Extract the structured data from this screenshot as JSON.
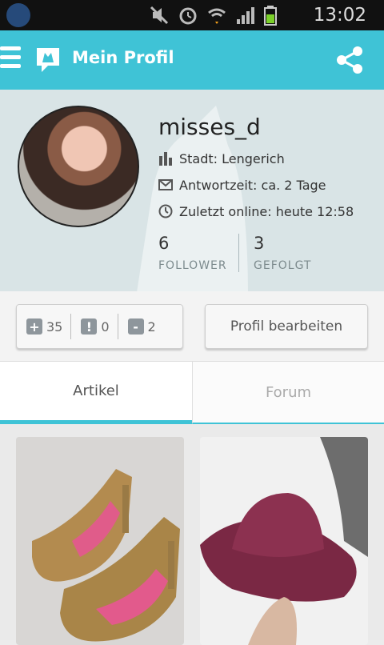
{
  "status_bar": {
    "time": "13:02"
  },
  "app_bar": {
    "title": "Mein Profil"
  },
  "profile": {
    "username": "misses_d",
    "city": "Stadt: Lengerich",
    "reply_time": "Antwortzeit: ca. 2 Tage",
    "last_online": "Zuletzt online: heute 12:58",
    "followers": {
      "count": "6",
      "label": "FOLLOWER"
    },
    "following": {
      "count": "3",
      "label": "GEFOLGT"
    }
  },
  "votes": [
    {
      "symbol": "+",
      "count": "35"
    },
    {
      "symbol": "!",
      "count": "0"
    },
    {
      "symbol": "-",
      "count": "2"
    }
  ],
  "edit_profile_label": "Profil bearbeiten",
  "tabs": [
    {
      "label": "Artikel",
      "active": true
    },
    {
      "label": "Forum",
      "active": false
    }
  ],
  "colors": {
    "accent": "#3fc3d6"
  }
}
